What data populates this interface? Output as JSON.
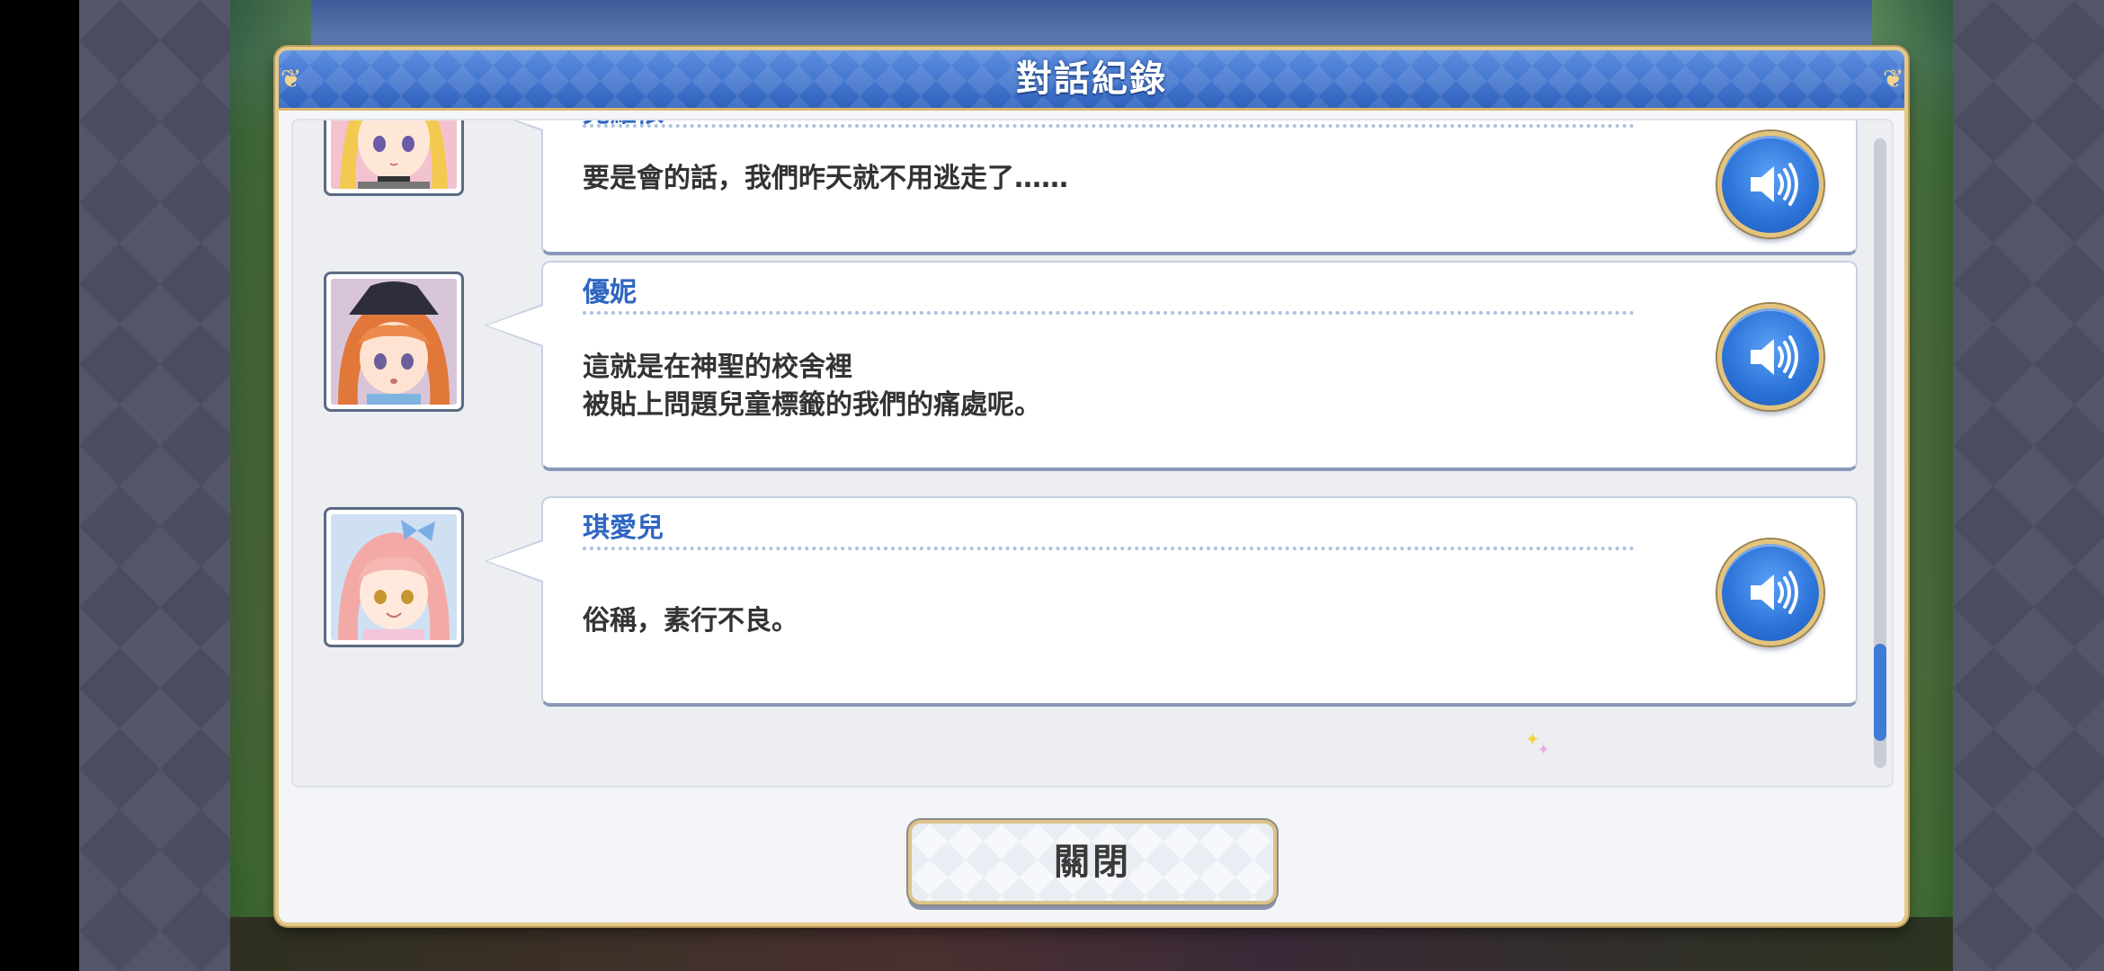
{
  "dialog": {
    "title": "對話紀錄",
    "close_label": "關閉"
  },
  "entries": [
    {
      "speaker": "克蘿依",
      "lines": [
        "要是會的話，我們昨天就不用逃走了……"
      ],
      "portrait_icon": "portrait-chloe-icon",
      "voice_icon": "speaker-volume-icon"
    },
    {
      "speaker": "優妮",
      "lines": [
        "這就是在神聖的校舍裡",
        "被貼上問題兒童標籤的我們的痛處呢。"
      ],
      "portrait_icon": "portrait-yuni-icon",
      "voice_icon": "speaker-volume-icon"
    },
    {
      "speaker": "琪愛兒",
      "lines": [
        "俗稱，素行不良。"
      ],
      "portrait_icon": "portrait-chieru-icon",
      "voice_icon": "speaker-volume-icon"
    }
  ],
  "scroll": {
    "position_fraction": 0.95
  },
  "colors": {
    "header_blue": "#3c71c9",
    "speaker_name": "#2f66c2",
    "gold_border": "#e5c98a",
    "voice_button": "#2b72d8"
  }
}
